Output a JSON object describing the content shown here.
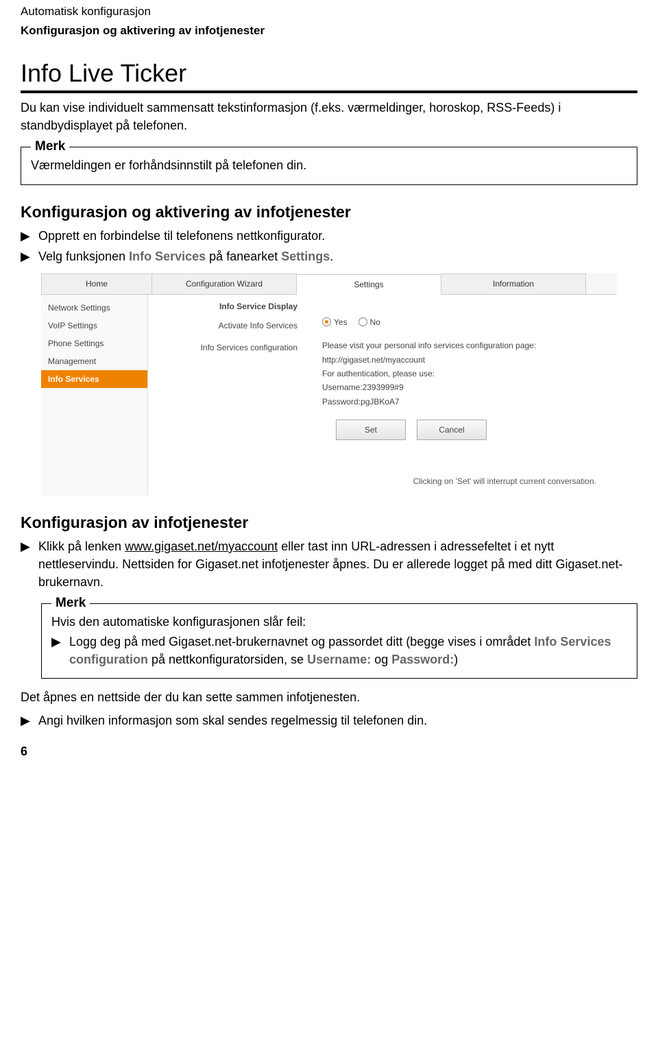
{
  "header": {
    "line1": "Automatisk konfigurasjon",
    "line2": "Konfigurasjon og aktivering av infotjenester"
  },
  "h1": "Info Live Ticker",
  "intro": "Du kan vise individuelt sammensatt tekstinformasjon (f.eks. værmeldinger, horoskop, RSS-Feeds) i standbydisplayet på telefonen.",
  "note1": {
    "title": "Merk",
    "body": "Værmeldingen er forhåndsinnstilt på telefonen din."
  },
  "h2a": "Konfigurasjon og aktivering av infotjenester",
  "bul1": "Opprett en forbindelse til telefonens nettkonfigurator.",
  "bul2_a": "Velg funksjonen ",
  "bul2_b": "Info Services",
  "bul2_c": " på fanearket ",
  "bul2_d": "Settings",
  "bul2_e": ".",
  "figure": {
    "tabs": [
      "Home",
      "Configuration Wizard",
      "Settings",
      "Information"
    ],
    "activeTab": "Settings",
    "sidebar": [
      "Network Settings",
      "VoIP Settings",
      "Phone Settings",
      "Management",
      "Info Services"
    ],
    "activeSidebar": "Info Services",
    "midTitle": "Info Service Display",
    "midItems": [
      "Activate Info Services",
      "Info Services configuration"
    ],
    "yes": "Yes",
    "no": "No",
    "line1": "Please visit your personal info services configuration page:",
    "line2": "http://gigaset.net/myaccount",
    "line3": "For authentication, please use:",
    "line4": "Username:2393999#9",
    "line5": "Password:pgJBKoA7",
    "setBtn": "Set",
    "cancelBtn": "Cancel",
    "footnote": "Clicking on 'Set' will interrupt current conversation."
  },
  "h2b": "Konfigurasjon av infotjenester",
  "bul3_a": "Klikk på lenken ",
  "bul3_link": "www.gigaset.net/myaccount",
  "bul3_b": " eller tast inn URL-adressen i adressefeltet i et nytt nettleservindu. Nettsiden for Gigaset.net infotjenester åpnes. Du er allerede logget på med ditt Gigaset.net-brukernavn.",
  "note2": {
    "title": "Merk",
    "line1": "Hvis den automatiske konfigurasjonen slår feil:",
    "bul_a": "Logg deg på med Gigaset.net-brukernavnet og passordet ditt (begge vises i området ",
    "bul_b": "Info Services configuration",
    "bul_c": " på nettkonfiguratorsiden, se ",
    "bul_d": "Username:",
    "bul_e": " og ",
    "bul_f": "Password:",
    "bul_g": ")"
  },
  "outro": "Det åpnes en nettside der du kan sette sammen infotjenesten.",
  "bul4": "Angi hvilken informasjon som skal sendes regelmessig til telefonen din.",
  "pagenum": "6"
}
